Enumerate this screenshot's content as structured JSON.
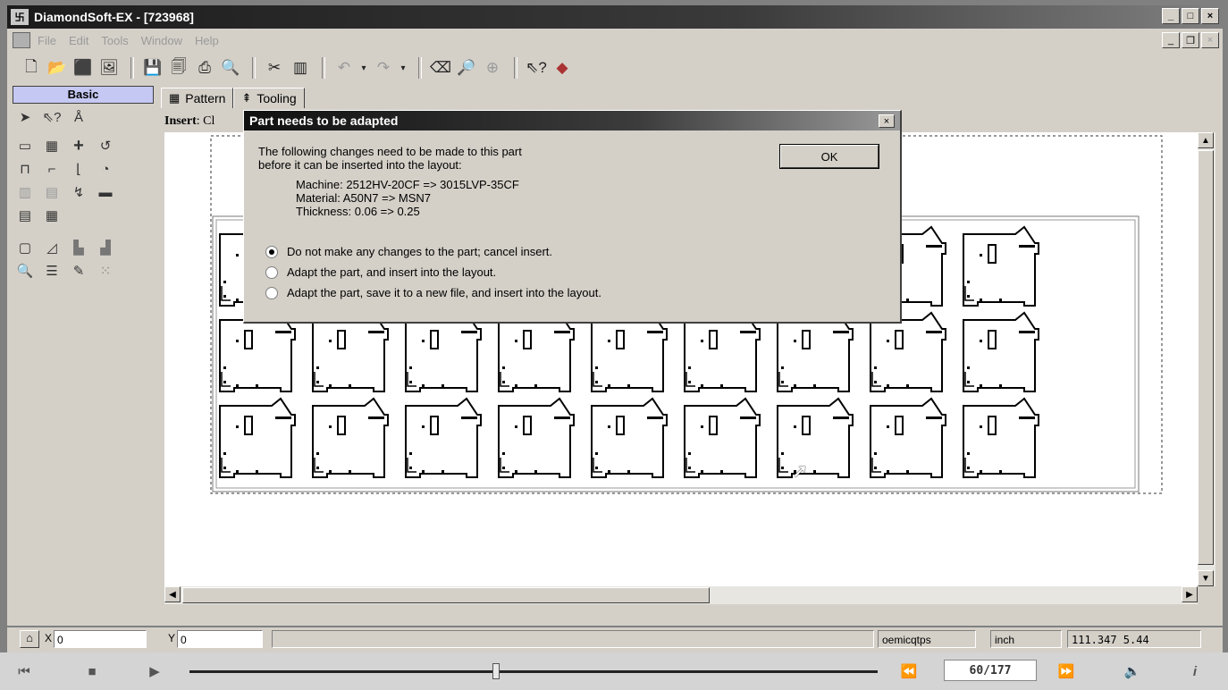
{
  "window": {
    "title": "DiamondSoft-EX - [723968]",
    "app_icon": "grid-app-icon"
  },
  "menu": {
    "items": [
      "File",
      "Edit",
      "Tools",
      "Window",
      "Help"
    ]
  },
  "toolbar": {
    "icons": [
      "new-document-icon",
      "open-folder-icon",
      "import-icon",
      "view-image-icon",
      "save-icon",
      "save-all-icon",
      "print-icon",
      "print-preview-icon",
      "cut-pattern-icon",
      "layout-icon",
      "undo-icon",
      "redo-icon",
      "eraser-icon",
      "zoom-window-icon",
      "zoom-fit-icon",
      "context-help-icon",
      "settings-icon"
    ]
  },
  "left_panel": {
    "tab_label": "Basic"
  },
  "tabs": [
    {
      "label": "Pattern",
      "icon": "pattern-grid-icon"
    },
    {
      "label": "Tooling",
      "icon": "tooling-icon"
    }
  ],
  "insert_label": {
    "prefix": "Insert",
    "value": ": Cl"
  },
  "dialog": {
    "title": "Part needs to be adapted",
    "close": "×",
    "message_line1": "The following changes need to be made to this part",
    "message_line2": "before it can be inserted into the layout:",
    "changes": [
      "Machine: 2512HV-20CF  =>  3015LVP-35CF",
      "Material: A50N7  =>  MSN7",
      "Thickness: 0.06  =>  0.25"
    ],
    "ok_label": "OK",
    "options": [
      {
        "label": "Do not make any changes to the part; cancel insert.",
        "selected": true
      },
      {
        "label": "Adapt the part, and insert into the layout.",
        "selected": false
      },
      {
        "label": "Adapt the part, save it to a new file, and insert into the layout.",
        "selected": false
      }
    ]
  },
  "status": {
    "x_label": "X",
    "x_value": "0",
    "y_label": "Y",
    "y_value": "0",
    "user": "oemicqtps",
    "units": "inch",
    "coords": "111.347 5.44"
  },
  "player": {
    "page": "60/177",
    "progress": 0.446
  }
}
